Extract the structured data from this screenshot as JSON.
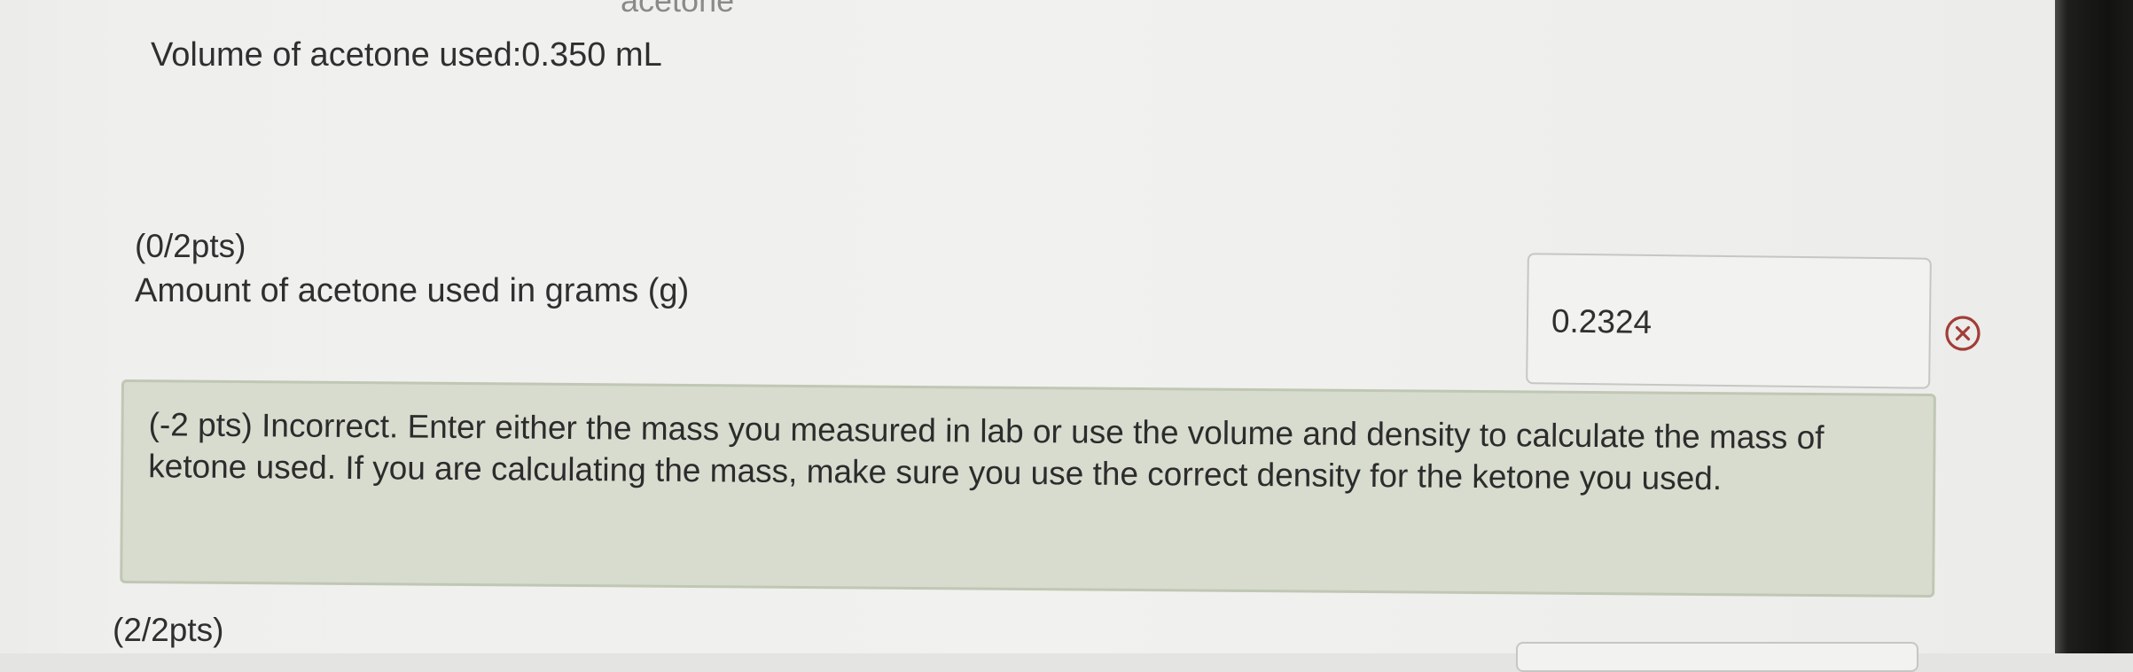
{
  "previous_header": {
    "clipped_text": "acetone"
  },
  "data_line": {
    "text": "Volume of acetone used:0.350 mL"
  },
  "question": {
    "points": "(0/2pts)",
    "label": "Amount of acetone used in grams (g)",
    "answer_value": "0.2324",
    "status_icon": "incorrect-circle-x-icon",
    "status_color": "#a23d37"
  },
  "feedback": {
    "text": "(-2 pts) Incorrect. Enter either the mass you measured in lab or use the volume and density to calculate the mass of ketone used. If you are calculating the mass, make sure you use the correct density for the ketone you used.",
    "background_color": "#d7dccf",
    "border_color": "#c0c7b4"
  },
  "next_question": {
    "points": "(2/2pts)"
  }
}
